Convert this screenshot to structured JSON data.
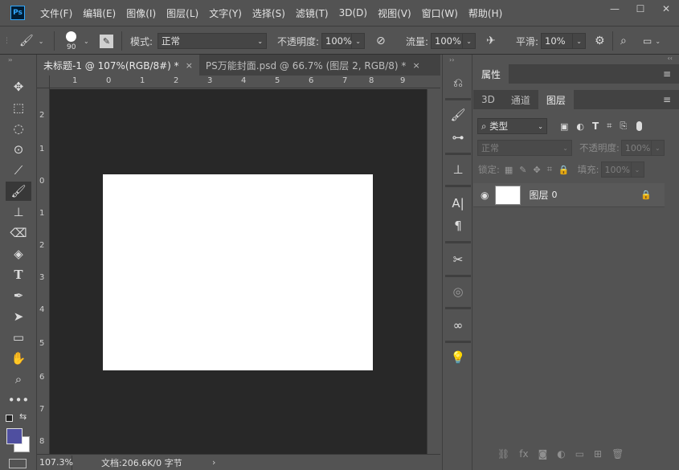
{
  "app": {
    "logo": "Ps"
  },
  "menu": [
    "文件(F)",
    "编辑(E)",
    "图像(I)",
    "图层(L)",
    "文字(Y)",
    "选择(S)",
    "滤镜(T)",
    "3D(D)",
    "视图(V)",
    "窗口(W)",
    "帮助(H)"
  ],
  "window": {
    "minimize": "—",
    "maximize": "☐",
    "close": "✕"
  },
  "options": {
    "brush_size": "90",
    "mode_label": "模式:",
    "mode_value": "正常",
    "opacity_label": "不透明度:",
    "opacity_value": "100%",
    "flow_label": "流量:",
    "flow_value": "100%",
    "smooth_label": "平滑:",
    "smooth_value": "10%"
  },
  "tabs": [
    {
      "label": "未标题-1 @ 107%(RGB/8#) *",
      "close": "×",
      "active": true
    },
    {
      "label": "PS万能封面.psd @ 66.7% (图层 2, RGB/8) *",
      "close": "×",
      "active": false
    }
  ],
  "ruler": {
    "top": [
      "1",
      "0",
      "1",
      "2",
      "3",
      "4",
      "5",
      "6",
      "7",
      "8",
      "9"
    ],
    "left": [
      "2",
      "1",
      "0",
      "1",
      "2",
      "3",
      "4",
      "5",
      "6",
      "7",
      "8"
    ]
  },
  "status": {
    "zoom": "107.3%",
    "doc_info": "文档:206.6K/0 字节",
    "arrow": "›"
  },
  "properties_panel": {
    "title": "属性"
  },
  "layers_panel": {
    "tabs": [
      "3D",
      "通道",
      "图层"
    ],
    "active_tab": "图层",
    "filter_kind": "类型",
    "blend_mode": "正常",
    "opacity_label": "不透明度:",
    "opacity_value": "100%",
    "lock_label": "锁定:",
    "fill_label": "填充:",
    "fill_value": "100%",
    "layers": [
      {
        "name": "图层",
        "index": "0",
        "visible": true,
        "locked": true
      }
    ]
  },
  "colors": {
    "foreground": "#4f4fa0",
    "background": "#ffffff",
    "accent": "#31a8ff",
    "panel": "#535353"
  }
}
